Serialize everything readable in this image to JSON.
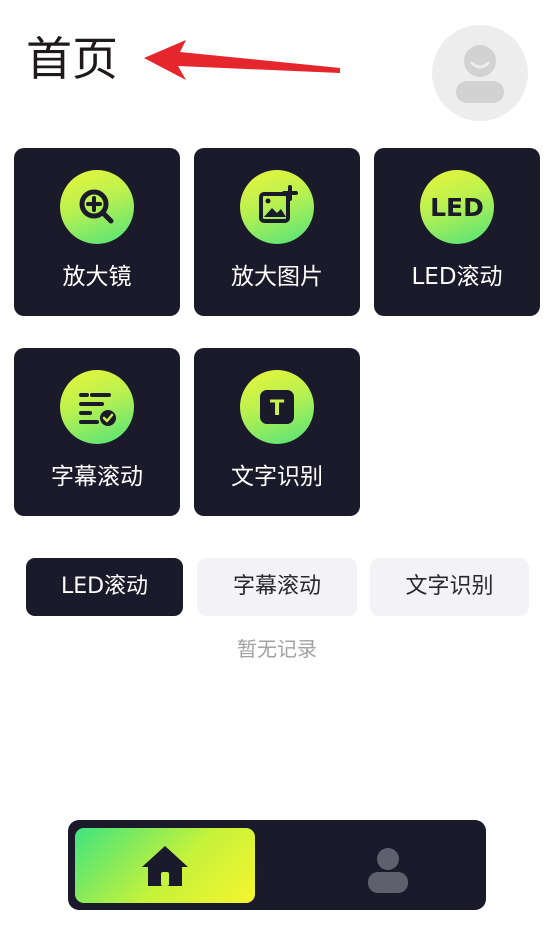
{
  "header": {
    "title": "首页",
    "avatar_icon": "user-avatar-icon",
    "annotation_icon": "red-arrow-icon",
    "annotation_color": "#e5262c"
  },
  "tiles": [
    {
      "label": "放大镜",
      "icon": "magnifier-plus-icon"
    },
    {
      "label": "放大图片",
      "icon": "image-add-icon"
    },
    {
      "label": "LED滚动",
      "icon": "led-icon",
      "icon_text": "LED"
    },
    {
      "label": "字幕滚动",
      "icon": "subtitle-list-icon"
    },
    {
      "label": "文字识别",
      "icon": "text-recognition-icon",
      "icon_text": "T"
    }
  ],
  "record_tabs": {
    "items": [
      "LED滚动",
      "字幕滚动",
      "文字识别"
    ],
    "selected": "LED滚动",
    "empty_text": "暂无记录"
  },
  "bottom_nav": {
    "items": [
      {
        "name": "home",
        "icon": "home-icon",
        "active": true
      },
      {
        "name": "profile",
        "icon": "person-icon",
        "active": false
      }
    ]
  },
  "colors": {
    "tile_background": "#1b1a2a",
    "accent_gradient": [
      "#eaf53a",
      "#4fe27c"
    ],
    "tab_inactive_background": "#f3f3f7",
    "empty_text": "#a2a2a2"
  }
}
